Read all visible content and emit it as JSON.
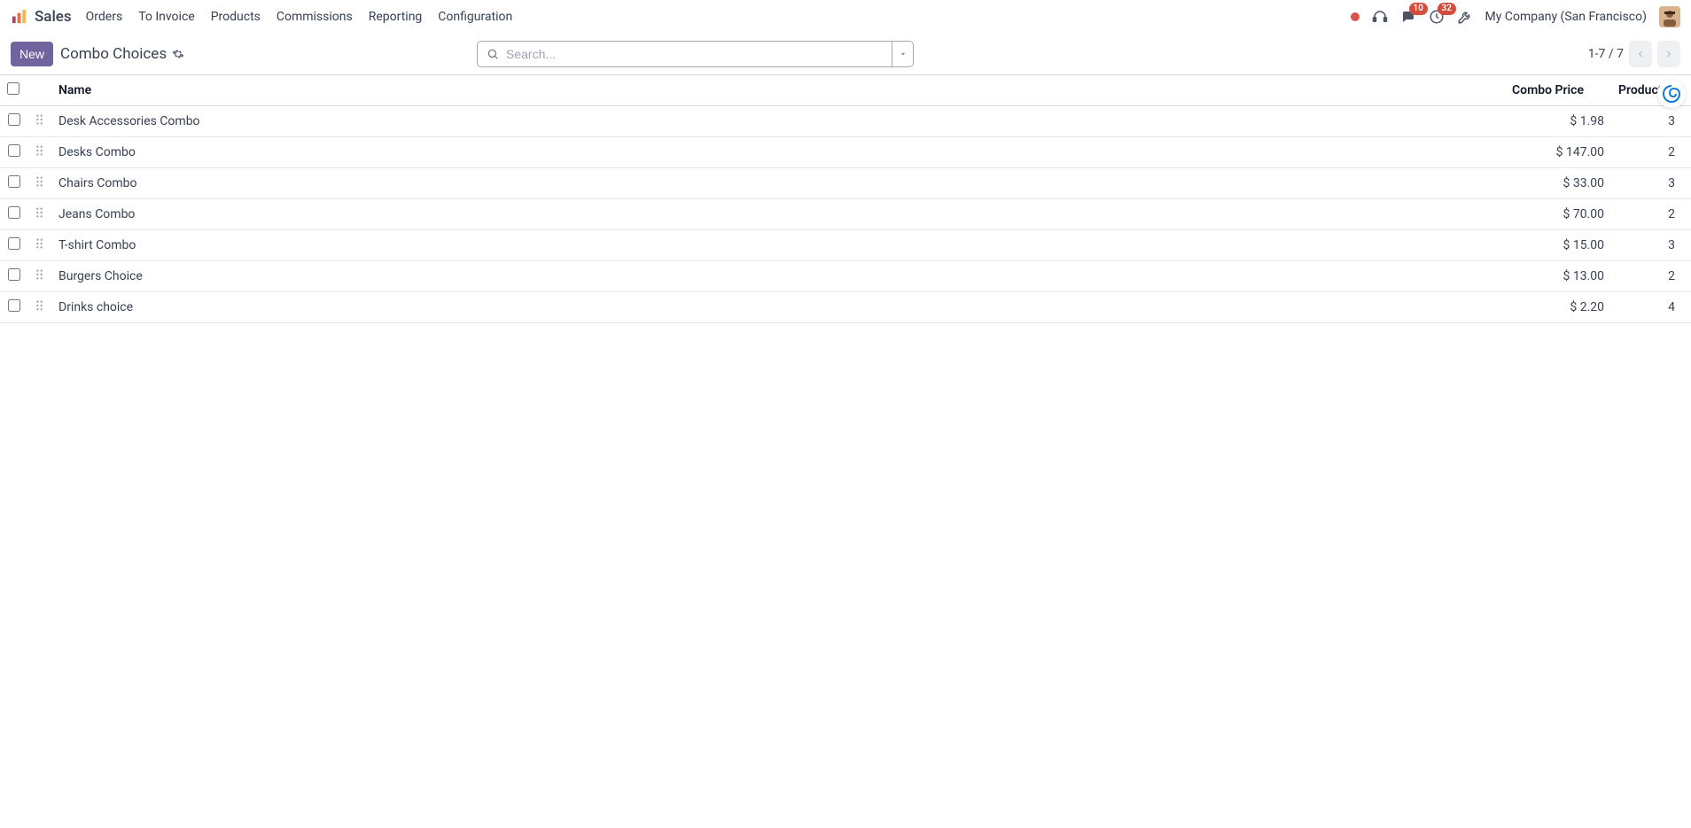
{
  "navbar": {
    "app_name": "Sales",
    "links": [
      "Orders",
      "To Invoice",
      "Products",
      "Commissions",
      "Reporting",
      "Configuration"
    ],
    "chat_badge": "10",
    "activity_badge": "32",
    "company": "My Company (San Francisco)"
  },
  "control": {
    "new_label": "New",
    "title": "Combo Choices",
    "search_placeholder": "Search...",
    "pager_text": "1-7 / 7"
  },
  "table": {
    "headers": {
      "name": "Name",
      "price": "Combo Price",
      "count": "Product ..."
    },
    "rows": [
      {
        "name": "Desk Accessories Combo",
        "price": "$ 1.98",
        "count": "3"
      },
      {
        "name": "Desks Combo",
        "price": "$ 147.00",
        "count": "2"
      },
      {
        "name": "Chairs Combo",
        "price": "$ 33.00",
        "count": "3"
      },
      {
        "name": "Jeans Combo",
        "price": "$ 70.00",
        "count": "2"
      },
      {
        "name": "T-shirt Combo",
        "price": "$ 15.00",
        "count": "3"
      },
      {
        "name": "Burgers Choice",
        "price": "$ 13.00",
        "count": "2"
      },
      {
        "name": "Drinks choice",
        "price": "$ 2.20",
        "count": "4"
      }
    ]
  }
}
